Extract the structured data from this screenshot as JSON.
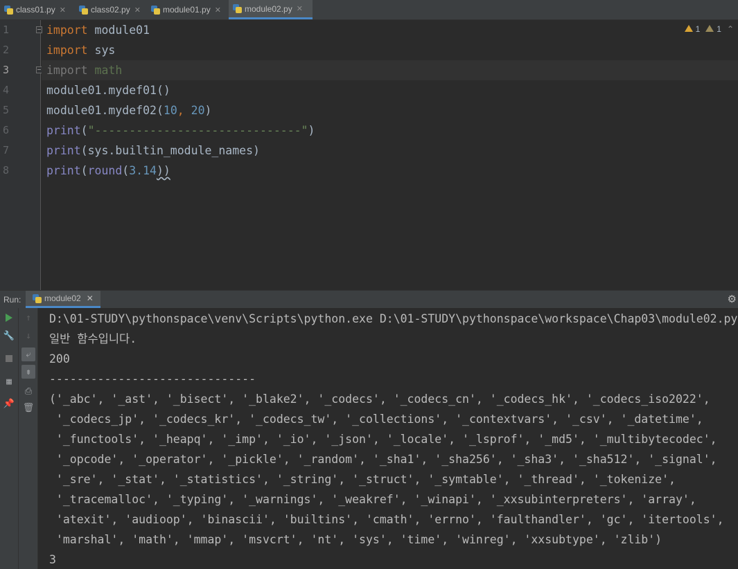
{
  "tabs": [
    {
      "label": "class01.py",
      "active": false
    },
    {
      "label": "class02.py",
      "active": false
    },
    {
      "label": "module01.py",
      "active": false
    },
    {
      "label": "module02.py",
      "active": true
    }
  ],
  "warnings": {
    "strong_count": "1",
    "weak_count": "1"
  },
  "editor": {
    "line_numbers": [
      "1",
      "2",
      "3",
      "4",
      "5",
      "6",
      "7",
      "8"
    ],
    "lines": [
      [
        {
          "t": "import",
          "c": "kw"
        },
        {
          "t": " module01",
          "c": "plain"
        }
      ],
      [
        {
          "t": "import",
          "c": "kw"
        },
        {
          "t": " sys",
          "c": "plain"
        }
      ],
      [
        {
          "t": "import",
          "c": "kw-dim"
        },
        {
          "t": " math",
          "c": "mod-dim"
        }
      ],
      [
        {
          "t": "module01.mydef01()",
          "c": "plain"
        }
      ],
      [
        {
          "t": "module01.mydef02(",
          "c": "plain"
        },
        {
          "t": "10",
          "c": "num"
        },
        {
          "t": ", ",
          "c": "kw"
        },
        {
          "t": "20",
          "c": "num"
        },
        {
          "t": ")",
          "c": "plain"
        }
      ],
      [
        {
          "t": "print",
          "c": "fn"
        },
        {
          "t": "(",
          "c": "plain"
        },
        {
          "t": "\"------------------------------\"",
          "c": "str"
        },
        {
          "t": ")",
          "c": "plain"
        }
      ],
      [
        {
          "t": "print",
          "c": "fn"
        },
        {
          "t": "(sys.builtin_module_names)",
          "c": "plain"
        }
      ],
      [
        {
          "t": "print",
          "c": "fn"
        },
        {
          "t": "(",
          "c": "plain"
        },
        {
          "t": "round",
          "c": "fn"
        },
        {
          "t": "(",
          "c": "plain"
        },
        {
          "t": "3.14",
          "c": "num"
        },
        {
          "t": "))",
          "c": "plain squig"
        }
      ]
    ],
    "current_line": 3
  },
  "run": {
    "label": "Run:",
    "tab_label": "module02"
  },
  "console": [
    "D:\\01-STUDY\\pythonspace\\venv\\Scripts\\python.exe D:\\01-STUDY\\pythonspace\\workspace\\Chap03\\module02.py",
    "일반 함수입니다.",
    "200",
    "------------------------------",
    "('_abc', '_ast', '_bisect', '_blake2', '_codecs', '_codecs_cn', '_codecs_hk', '_codecs_iso2022',",
    " '_codecs_jp', '_codecs_kr', '_codecs_tw', '_collections', '_contextvars', '_csv', '_datetime',",
    " '_functools', '_heapq', '_imp', '_io', '_json', '_locale', '_lsprof', '_md5', '_multibytecodec',",
    " '_opcode', '_operator', '_pickle', '_random', '_sha1', '_sha256', '_sha3', '_sha512', '_signal',",
    " '_sre', '_stat', '_statistics', '_string', '_struct', '_symtable', '_thread', '_tokenize',",
    " '_tracemalloc', '_typing', '_warnings', '_weakref', '_winapi', '_xxsubinterpreters', 'array',",
    " 'atexit', 'audioop', 'binascii', 'builtins', 'cmath', 'errno', 'faulthandler', 'gc', 'itertools',",
    " 'marshal', 'math', 'mmap', 'msvcrt', 'nt', 'sys', 'time', 'winreg', 'xxsubtype', 'zlib')",
    "3"
  ],
  "icons": {
    "tab_file": "python-file-icon",
    "warning": "warning-icon",
    "run": "run-icon",
    "wrench": "wrench-icon",
    "stop": "stop-icon",
    "layout": "layout-icon",
    "pin": "pin-icon",
    "up": "arrow-up-icon",
    "down": "arrow-down-icon",
    "wrap": "soft-wrap-icon",
    "scroll": "scroll-to-end-icon",
    "print": "print-icon",
    "trash": "trash-icon",
    "settings": "gear-icon"
  }
}
